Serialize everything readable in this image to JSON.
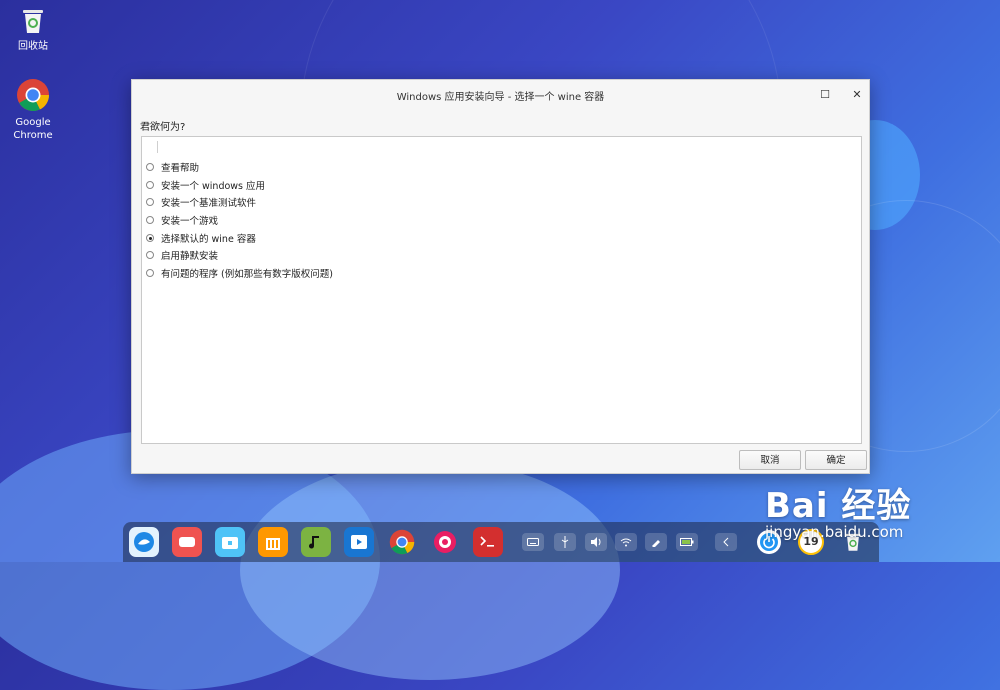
{
  "desktop": {
    "icons": [
      {
        "label": "回收站"
      },
      {
        "label": "Google Chrome"
      }
    ]
  },
  "dialog": {
    "title": "Windows 应用安装向导 - 选择一个 wine 容器",
    "prompt": "君欲何为?",
    "options": [
      {
        "label": "查看帮助",
        "selected": false
      },
      {
        "label": "安装一个 windows 应用",
        "selected": false
      },
      {
        "label": "安装一个基准测试软件",
        "selected": false
      },
      {
        "label": "安装一个游戏",
        "selected": false
      },
      {
        "label": "选择默认的 wine 容器",
        "selected": true
      },
      {
        "label": "启用静默安装",
        "selected": false
      },
      {
        "label": "有问题的程序 (例如那些有数字版权问题)",
        "selected": false
      }
    ],
    "cancel_label": "取消",
    "ok_label": "确定",
    "maximize_glyph": "☐",
    "close_glyph": "✕"
  },
  "dock": {
    "apps": [
      {
        "icon": "deepin-launcher-icon",
        "color": "#1e88e5"
      },
      {
        "icon": "screen-recorder-icon",
        "color": "#ef5350"
      },
      {
        "icon": "file-manager-icon",
        "color": "#4fc3f7"
      },
      {
        "icon": "app-store-icon",
        "color": "#ff9800"
      },
      {
        "icon": "music-icon",
        "color": "#7cb342"
      },
      {
        "icon": "video-icon",
        "color": "#1976d2"
      },
      {
        "icon": "chrome-icon",
        "color": "#ffffff"
      },
      {
        "icon": "settings-icon",
        "color": "#e91e63"
      },
      {
        "icon": "terminal-icon",
        "color": "#d32f2f"
      }
    ],
    "tray": [
      "keyboard-icon",
      "usb-icon",
      "volume-icon",
      "wifi-icon",
      "pen-icon",
      "battery-icon",
      "chevron-left-icon"
    ],
    "clock_text": "19"
  },
  "watermark": {
    "main": "Bai 经验",
    "sub": "jingyan.baidu.com"
  }
}
